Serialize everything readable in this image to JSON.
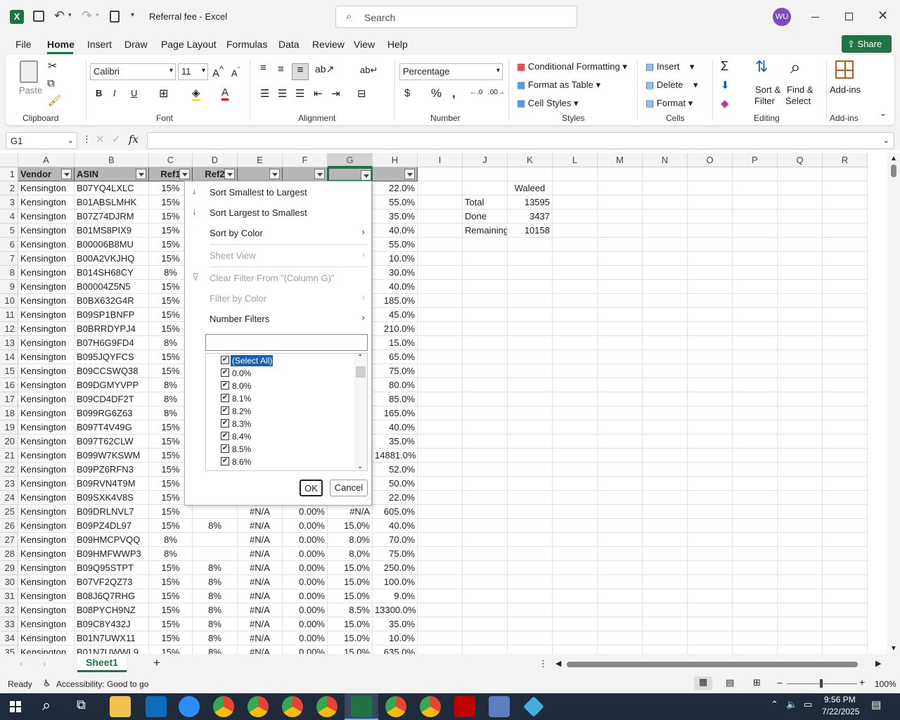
{
  "app": {
    "title": "Referral fee  -  Excel",
    "search_placeholder": "Search",
    "user_initials": "WU",
    "share_label": "Share",
    "accent": "#217346"
  },
  "menu_tabs": [
    "File",
    "Home",
    "Insert",
    "Draw",
    "Page Layout",
    "Formulas",
    "Data",
    "Review",
    "View",
    "Help"
  ],
  "ribbon": {
    "clipboard": {
      "paste": "Paste",
      "label": "Clipboard"
    },
    "font": {
      "name": "Calibri",
      "size": "11",
      "label": "Font"
    },
    "alignment": {
      "label": "Alignment"
    },
    "number": {
      "format": "Percentage",
      "label": "Number"
    },
    "styles": {
      "conditional": "Conditional Formatting",
      "format_table": "Format as Table",
      "cell_styles": "Cell Styles",
      "label": "Styles"
    },
    "cells": {
      "insert": "Insert",
      "delete": "Delete",
      "format": "Format",
      "label": "Cells"
    },
    "editing": {
      "sort_filter_1": "Sort &",
      "sort_filter_2": "Filter",
      "find_select_1": "Find &",
      "find_select_2": "Select",
      "label": "Editing"
    },
    "addins": {
      "label1": "Add-ins",
      "label2": "Add-ins"
    }
  },
  "formula_bar": {
    "name_box": "G1",
    "fx": "fx",
    "content": ""
  },
  "columns": [
    "A",
    "B",
    "C",
    "D",
    "E",
    "F",
    "G",
    "H",
    "I",
    "J",
    "K",
    "L",
    "M",
    "N",
    "O",
    "P",
    "Q",
    "R"
  ],
  "header_row": {
    "A": "Vendor",
    "B": "ASIN",
    "C": "Ref1",
    "D": "Ref2",
    "E": "",
    "F": "",
    "G": "",
    "H": ""
  },
  "rows": [
    {
      "n": "2",
      "A": "Kensington",
      "B": "B07YQ4LXLC",
      "C": "15%",
      "H": "22.0%"
    },
    {
      "n": "3",
      "A": "Kensington",
      "B": "B01ABSLMHK",
      "C": "15%",
      "H": "55.0%"
    },
    {
      "n": "4",
      "A": "Kensington",
      "B": "B07Z74DJRM",
      "C": "15%",
      "H": "35.0%"
    },
    {
      "n": "5",
      "A": "Kensington",
      "B": "B01MS8PIX9",
      "C": "15%",
      "H": "40.0%"
    },
    {
      "n": "6",
      "A": "Kensington",
      "B": "B00006B8MU",
      "C": "15%",
      "H": "55.0%"
    },
    {
      "n": "7",
      "A": "Kensington",
      "B": "B00A2VKJHQ",
      "C": "15%",
      "H": "10.0%"
    },
    {
      "n": "8",
      "A": "Kensington",
      "B": "B014SH68CY",
      "C": "8%",
      "H": "30.0%"
    },
    {
      "n": "9",
      "A": "Kensington",
      "B": "B00004Z5N5",
      "C": "15%",
      "H": "40.0%"
    },
    {
      "n": "10",
      "A": "Kensington",
      "B": "B0BX632G4R",
      "C": "15%",
      "H": "185.0%"
    },
    {
      "n": "11",
      "A": "Kensington",
      "B": "B09SP1BNFP",
      "C": "15%",
      "H": "45.0%"
    },
    {
      "n": "12",
      "A": "Kensington",
      "B": "B0BRRDYPJ4",
      "C": "15%",
      "H": "210.0%"
    },
    {
      "n": "13",
      "A": "Kensington",
      "B": "B07H6G9FD4",
      "C": "8%",
      "H": "15.0%"
    },
    {
      "n": "14",
      "A": "Kensington",
      "B": "B095JQYFCS",
      "C": "15%",
      "H": "65.0%"
    },
    {
      "n": "15",
      "A": "Kensington",
      "B": "B09CCSWQ38",
      "C": "15%",
      "H": "75.0%"
    },
    {
      "n": "16",
      "A": "Kensington",
      "B": "B09DGMYVPP",
      "C": "8%",
      "H": "80.0%"
    },
    {
      "n": "17",
      "A": "Kensington",
      "B": "B09CD4DF2T",
      "C": "8%",
      "H": "85.0%"
    },
    {
      "n": "18",
      "A": "Kensington",
      "B": "B099RG6Z63",
      "C": "8%",
      "H": "165.0%"
    },
    {
      "n": "19",
      "A": "Kensington",
      "B": "B097T4V49G",
      "C": "15%",
      "H": "40.0%"
    },
    {
      "n": "20",
      "A": "Kensington",
      "B": "B097T62CLW",
      "C": "15%",
      "H": "35.0%"
    },
    {
      "n": "21",
      "A": "Kensington",
      "B": "B099W7KSWM",
      "C": "15%",
      "H": "14881.0%"
    },
    {
      "n": "22",
      "A": "Kensington",
      "B": "B09PZ6RFN3",
      "C": "15%",
      "H": "52.0%"
    },
    {
      "n": "23",
      "A": "Kensington",
      "B": "B09RVN4T9M",
      "C": "15%",
      "H": "50.0%"
    },
    {
      "n": "24",
      "A": "Kensington",
      "B": "B09SXK4V8S",
      "C": "15%",
      "H": "22.0%"
    },
    {
      "n": "25",
      "A": "Kensington",
      "B": "B09DRLNVL7",
      "C": "15%",
      "D": "",
      "E": "#N/A",
      "F": "0.00%",
      "G": "#N/A",
      "H": "605.0%"
    },
    {
      "n": "26",
      "A": "Kensington",
      "B": "B09PZ4DL97",
      "C": "15%",
      "D": "8%",
      "E": "#N/A",
      "F": "0.00%",
      "G": "15.0%",
      "H": "40.0%"
    },
    {
      "n": "27",
      "A": "Kensington",
      "B": "B09HMCPVQQ",
      "C": "8%",
      "D": "",
      "E": "#N/A",
      "F": "0.00%",
      "G": "8.0%",
      "H": "70.0%"
    },
    {
      "n": "28",
      "A": "Kensington",
      "B": "B09HMFWWP3",
      "C": "8%",
      "D": "",
      "E": "#N/A",
      "F": "0.00%",
      "G": "8.0%",
      "H": "75.0%"
    },
    {
      "n": "29",
      "A": "Kensington",
      "B": "B09Q95STPT",
      "C": "15%",
      "D": "8%",
      "E": "#N/A",
      "F": "0.00%",
      "G": "15.0%",
      "H": "250.0%"
    },
    {
      "n": "30",
      "A": "Kensington",
      "B": "B07VF2QZ73",
      "C": "15%",
      "D": "8%",
      "E": "#N/A",
      "F": "0.00%",
      "G": "15.0%",
      "H": "100.0%"
    },
    {
      "n": "31",
      "A": "Kensington",
      "B": "B08J6Q7RHG",
      "C": "15%",
      "D": "8%",
      "E": "#N/A",
      "F": "0.00%",
      "G": "15.0%",
      "H": "9.0%"
    },
    {
      "n": "32",
      "A": "Kensington",
      "B": "B08PYCH9NZ",
      "C": "15%",
      "D": "8%",
      "E": "#N/A",
      "F": "0.00%",
      "G": "8.5%",
      "H": "13300.0%"
    },
    {
      "n": "33",
      "A": "Kensington",
      "B": "B09C8Y432J",
      "C": "15%",
      "D": "8%",
      "E": "#N/A",
      "F": "0.00%",
      "G": "15.0%",
      "H": "35.0%"
    },
    {
      "n": "34",
      "A": "Kensington",
      "B": "B01N7UWX11",
      "C": "15%",
      "D": "8%",
      "E": "#N/A",
      "F": "0.00%",
      "G": "15.0%",
      "H": "10.0%"
    },
    {
      "n": "35",
      "A": "Kensington",
      "B": "B01N7UWWL9",
      "C": "15%",
      "D": "8%",
      "E": "#N/A",
      "F": "0.00%",
      "G": "15.0%",
      "H": "635.0%"
    }
  ],
  "summary": {
    "title": "Waleed",
    "rows": [
      {
        "label": "Total",
        "value": "13595"
      },
      {
        "label": "Done",
        "value": "3437"
      },
      {
        "label": "Remaining",
        "value": "10158"
      }
    ]
  },
  "filter_menu": {
    "sort_asc": "Sort Smallest to Largest",
    "sort_desc": "Sort Largest to Smallest",
    "sort_color": "Sort by Color",
    "sheet_view": "Sheet View",
    "clear_filter": "Clear Filter From \"(Column G)\"",
    "filter_color": "Filter by Color",
    "number_filters": "Number Filters",
    "search_value": "",
    "items": [
      "(Select All)",
      "0.0%",
      "8.0%",
      "8.1%",
      "8.2%",
      "8.3%",
      "8.4%",
      "8.5%",
      "8.6%"
    ],
    "ok": "OK",
    "cancel": "Cancel"
  },
  "sheet_tabs": [
    "Sheet1"
  ],
  "status": {
    "ready": "Ready",
    "accessibility": "Accessibility: Good to go",
    "zoom": "100%"
  },
  "clock": {
    "time": "9:56 PM",
    "date": "7/22/2025"
  }
}
